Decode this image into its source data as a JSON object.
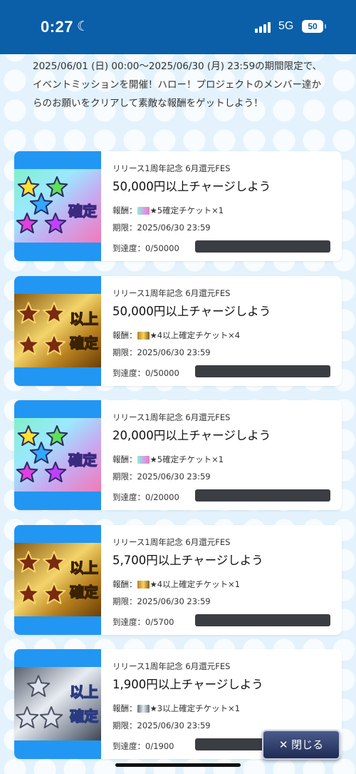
{
  "status_bar": {
    "time": "0:27",
    "moon_icon": "moon-icon",
    "network": "5G",
    "battery": "50"
  },
  "description": "2025/06/01 (日) 00:00～2025/06/30 (月) 23:59の期間限定で、イベントミッションを開催！ハロー！プロジェクトのメンバー達からのお願いをクリアして素敵な報酬をゲットしよう！",
  "missions": [
    {
      "event": "リリース1周年記念 6月還元FES",
      "title": "50,000円以上チャージしよう",
      "reward_label": "報酬：",
      "reward_text": "★5確定チケット×1",
      "deadline": "期限：2025/06/30 23:59",
      "progress_text": "到達度：0/50000",
      "progress_fraction": 0,
      "ticket_type": "star5",
      "ticket_label": "確定"
    },
    {
      "event": "リリース1周年記念 6月還元FES",
      "title": "50,000円以上チャージしよう",
      "reward_label": "報酬：",
      "reward_text": "★4以上確定チケット×4",
      "deadline": "期限：2025/06/30 23:59",
      "progress_text": "到達度：0/50000",
      "progress_fraction": 0,
      "ticket_type": "star4",
      "ticket_label": "以上確定"
    },
    {
      "event": "リリース1周年記念 6月還元FES",
      "title": "20,000円以上チャージしよう",
      "reward_label": "報酬：",
      "reward_text": "★5確定チケット×1",
      "deadline": "期限：2025/06/30 23:59",
      "progress_text": "到達度：0/20000",
      "progress_fraction": 0,
      "ticket_type": "star5",
      "ticket_label": "確定"
    },
    {
      "event": "リリース1周年記念 6月還元FES",
      "title": "5,700円以上チャージしよう",
      "reward_label": "報酬：",
      "reward_text": "★4以上確定チケット×1",
      "deadline": "期限：2025/06/30 23:59",
      "progress_text": "到達度：0/5700",
      "progress_fraction": 0,
      "ticket_type": "star4",
      "ticket_label": "以上確定"
    },
    {
      "event": "リリース1周年記念 6月還元FES",
      "title": "1,900円以上チャージしよう",
      "reward_label": "報酬：",
      "reward_text": "★3以上確定チケット×1",
      "deadline": "期限：2025/06/30 23:59",
      "progress_text": "到達度：0/1900",
      "progress_fraction": 0,
      "ticket_type": "star3",
      "ticket_label": "以上確定"
    }
  ],
  "close_button": {
    "icon": "close-icon",
    "label": "閉じる"
  },
  "colors": {
    "status_bar": "#0a5fa8",
    "card_accent": "#2296f3",
    "progress_track": "#3a3d42",
    "close_button": "#1f2b55"
  }
}
